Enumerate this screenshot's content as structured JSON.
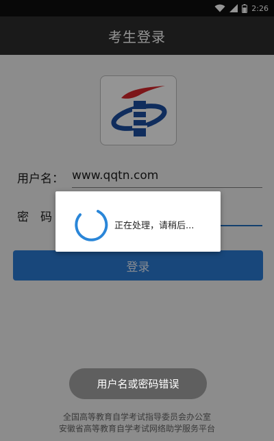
{
  "status_bar": {
    "time": "2:26",
    "icons": [
      "wifi-icon",
      "signal-icon",
      "battery-icon"
    ]
  },
  "app_bar": {
    "title": "考生登录"
  },
  "logo": {
    "icon": "institution-logo-icon",
    "colors": {
      "red": "#d7272b",
      "blue": "#1d4fa1"
    }
  },
  "form": {
    "username_label": "用户名：",
    "username_value": "www.qqtn.com",
    "password_label": "密　码"
  },
  "login_button": {
    "label": "登录",
    "color": "#2a7ad4"
  },
  "progress_dialog": {
    "message": "正在处理，请稍后..."
  },
  "toast": {
    "message": "用户名或密码错误"
  },
  "footer": {
    "line1": "全国高等教育自学考试指导委员会办公室",
    "line2": "安徽省高等教育自学考试网络助学服务平台"
  }
}
